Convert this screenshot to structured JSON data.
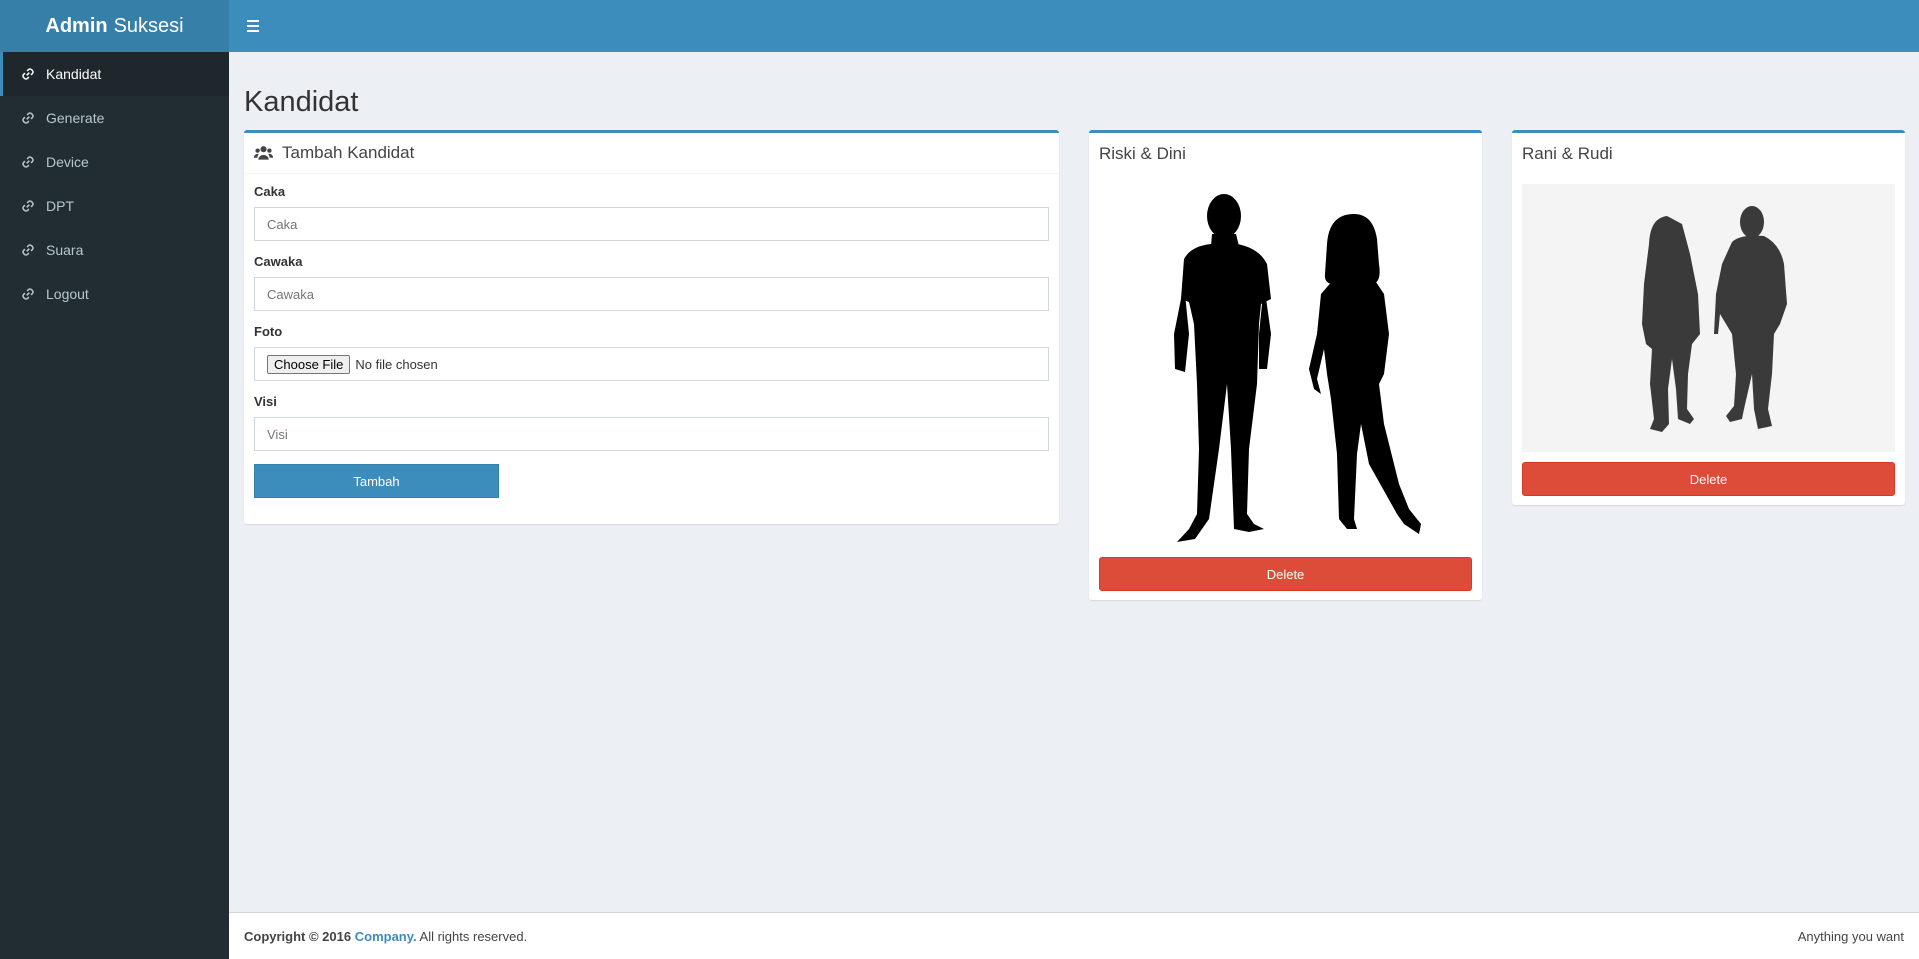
{
  "header": {
    "logo_bold": "Admin",
    "logo_light": "Suksesi"
  },
  "sidebar": {
    "items": [
      {
        "label": "Kandidat",
        "icon": "link-icon",
        "active": true
      },
      {
        "label": "Generate",
        "icon": "link-icon"
      },
      {
        "label": "Device",
        "icon": "link-icon"
      },
      {
        "label": "DPT",
        "icon": "link-icon"
      },
      {
        "label": "Suara",
        "icon": "link-icon"
      },
      {
        "label": "Logout",
        "icon": "link-icon"
      }
    ]
  },
  "page": {
    "title": "Kandidat"
  },
  "form_box": {
    "title": "Tambah Kandidat",
    "icon": "users-icon",
    "fields": {
      "caka": {
        "label": "Caka",
        "placeholder": "Caka",
        "value": ""
      },
      "cawaka": {
        "label": "Cawaka",
        "placeholder": "Cawaka",
        "value": ""
      },
      "foto": {
        "label": "Foto",
        "button": "Choose File",
        "status": "No file chosen"
      },
      "visi": {
        "label": "Visi",
        "placeholder": "Visi",
        "value": ""
      }
    },
    "submit_label": "Tambah"
  },
  "candidates": [
    {
      "title": "Riski & Dini",
      "delete_label": "Delete"
    },
    {
      "title": "Rani & Rudi",
      "delete_label": "Delete"
    }
  ],
  "footer": {
    "copyright": "Copyright © 2016",
    "company": "Company.",
    "rights": "All rights reserved.",
    "right_text": "Anything you want"
  },
  "colors": {
    "primary": "#3c8dbc",
    "danger": "#dd4b39",
    "sidebar": "#222d32",
    "background": "#ecf0f5"
  }
}
